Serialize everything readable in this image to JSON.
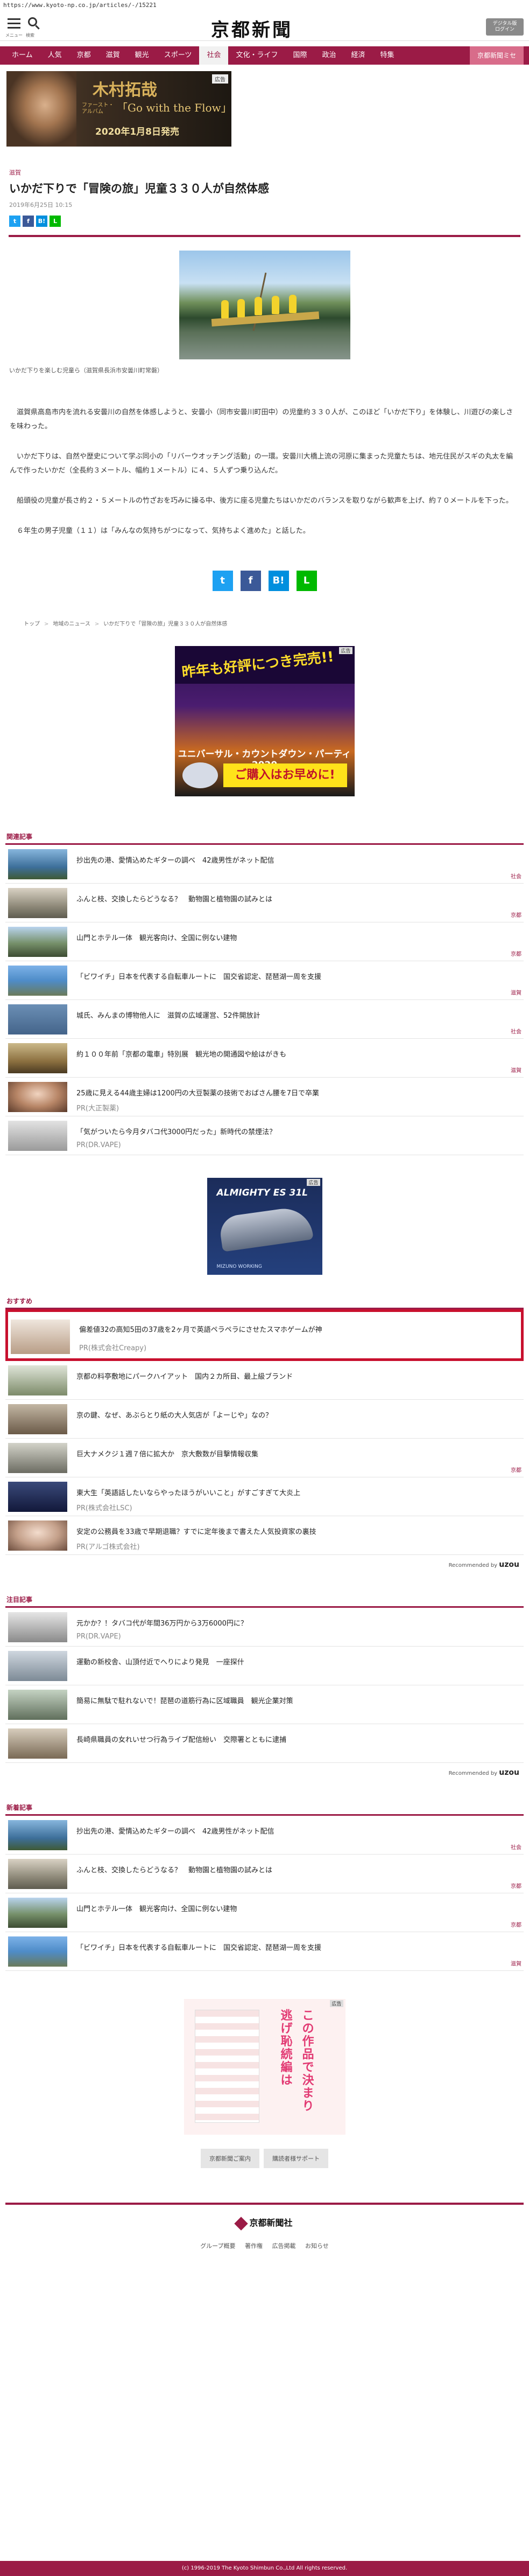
{
  "url": "https://www.kyoto-np.co.jp/articles/-/15221",
  "header": {
    "menu_label": "メニュー",
    "search_label": "検索",
    "logo": "京都新聞",
    "digital_button": "デジタル版\nログイン"
  },
  "nav": [
    "ホーム",
    "人気",
    "京都",
    "滋賀",
    "観光",
    "スポーツ",
    "社会",
    "文化・ライフ",
    "国際",
    "政治",
    "経済",
    "特集",
    "京都新聞ミセ"
  ],
  "banner": {
    "pr": "広告",
    "name": "木村拓哉",
    "album_caption": "ファースト・アルバム",
    "album_title": "「Go with the Flow」",
    "release": "2020年1月8日発売"
  },
  "article": {
    "section": "滋賀",
    "title": "いかだ下りで「冒険の旅」児童３３０人が自然体感",
    "date": "2019年6月25日 10:15",
    "photo_caption": "いかだ下りを楽しむ児童ら（滋賀県長浜市安曇川町常磐）",
    "paragraphs": [
      "滋賀県高島市内を流れる安曇川の自然を体感しようと、安曇小（同市安曇川町田中）の児童約３３０人が、このほど「いかだ下り」を体験し、川遊びの楽しさを味わった。",
      "いかだ下りは、自然や歴史について学ぶ同小の「リバーウオッチング活動」の一環。安曇川大橋上流の河原に集まった児童たちは、地元住民がスギの丸太を編んで作ったいかだ（全長約３メートル、幅約１メートル）に４、５人ずつ乗り込んだ。",
      "船頭役の児童が長さ約２・５メートルの竹ざおを巧みに操る中、後方に座る児童たちはいかだのバランスを取りながら歓声を上げ、約７０メートルを下った。",
      "６年生の男子児童（１１）は「みんなの気持ちがつになって、気持ちよく進めた」と話した。"
    ]
  },
  "share": {
    "twitter": "t",
    "facebook": "f",
    "hatena": "B!",
    "line": "L"
  },
  "breadcrumb": [
    "トップ",
    "地域のニュース",
    "いかだ下りで「冒険の旅」児童３３０人が自然体感"
  ],
  "ad1": {
    "pr": "広告",
    "headline": "昨年も好評につき完売!!",
    "event": "ユニバーサル・カウントダウン・パーティ 2020",
    "cta": "ご購入はお早めに!"
  },
  "related": {
    "title": "関連記事",
    "items": [
      {
        "title": "抄出先の港、愛情込めたギターの調べ　42歳男性がネット配信",
        "tag": "社会"
      },
      {
        "title": "ふんと枝、交換したらどうなる？　動物園と植物園の試みとは",
        "tag": "京都"
      },
      {
        "title": "山門とホテル一体　観光客向け、全国に例ない建物",
        "tag": "京都"
      },
      {
        "title": "「ビワイチ」日本を代表する自転車ルートに　国交省認定、琵琶湖一周を支援",
        "tag": "滋賀"
      },
      {
        "title": "城氏、みんまの博物他人に　滋賀の広域運営、52件開放計",
        "tag": "社会"
      },
      {
        "title": "約１００年前「京都の電車」特別展　観光地の開通図や絵はがきも",
        "tag": "滋賀"
      },
      {
        "title": "25歳に見える44歳主婦は1200円の大豆製薬の技術でおばさん腰を7日で卒業",
        "pr": "PR(大正製薬)"
      },
      {
        "title": "「気がついたら今月タバコ代3000円だった」新時代の禁煙法？",
        "pr": "PR(DR.VAPE)"
      }
    ]
  },
  "ad2": {
    "pr": "広告",
    "brand": "ALMIGHTY ES 31L",
    "label": "WORKING",
    "foot": "MIZUNO WORKING"
  },
  "recommend": {
    "title": "おすすめ",
    "items": [
      {
        "title": "偏差値32の高知5田の37歳を2ヶ月で英語ペラペラにさせたスマホゲームが神",
        "pr": "PR(株式会社Creapy)",
        "highlight": true
      },
      {
        "title": "京都の料亭敷地にパークハイアット　国内２カ所目、最上級ブランド"
      },
      {
        "title": "京の鍵、なぜ、あぶらとり紙の大人気店が「よーじや」なの？"
      },
      {
        "title": "巨大ナメクジ１週７倍に拡大か　京大敷数が目撃情報収集",
        "tag": "京都"
      },
      {
        "title": "東大生「英語話したいならやったほうがいいこと」がすごすぎて大炎上",
        "pr": "PR(株式会社LSC)"
      },
      {
        "title": "安定の公務員を33歳で早期退職？すでに定年後まで書えた人気投資家の裏技",
        "pr": "PR(アルゴ株式会社)"
      }
    ],
    "powered": "Recommended by",
    "powered_brand": "uzou"
  },
  "attention": {
    "title": "注目記事",
    "items": [
      {
        "title": "元かか？！タバコ代が年間36万円から3万6000円に？",
        "pr": "PR(DR.VAPE)"
      },
      {
        "title": "運動の新校舎、山頂付近でへりにより発見　一座探什"
      },
      {
        "title": "簡易に無駄で駐れないで！琵琶の道筋行為に区域職員　観光企業対策"
      },
      {
        "title": "長崎県職員の女れいせつ行為ライブ配信紛い　交際署とともに逮捕"
      }
    ],
    "powered": "Recommended by",
    "powered_brand": "uzou"
  },
  "latest": {
    "title": "新着記事",
    "items": [
      {
        "title": "抄出先の港、愛情込めたギターの調べ　42歳男性がネット配信",
        "tag": "社会"
      },
      {
        "title": "ふんと枝、交換したらどうなる？　動物園と植物園の試みとは",
        "tag": "京都"
      },
      {
        "title": "山門とホテル一体　観光客向け、全国に例ない建物",
        "tag": "京都"
      },
      {
        "title": "「ビワイチ」日本を代表する自転車ルートに　国交省認定、琵琶湖一周を支援",
        "tag": "滋賀"
      }
    ]
  },
  "ad3": {
    "pr": "広告",
    "line1": "逃げ恥続編は",
    "line2": "この作品で決まり"
  },
  "footer_buttons": [
    "京都新聞ご案内",
    "購読者様サポート"
  ],
  "footer": {
    "logo": "京都新聞社",
    "links": "グループ概要 著作権 広告掲載 お知らせ",
    "copyright": "(c) 1996-2019 The Kyoto Shimbun Co.,Ltd All rights reserved."
  }
}
